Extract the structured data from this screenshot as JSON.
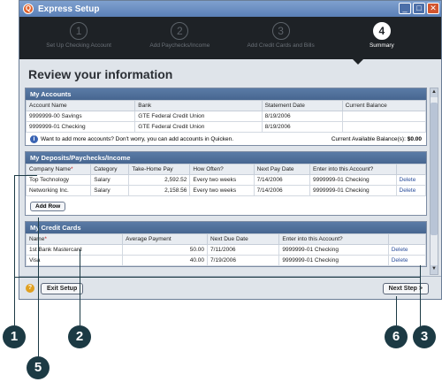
{
  "window": {
    "title": "Express Setup"
  },
  "steps": [
    {
      "num": "1",
      "label": "Set Up Checking Account"
    },
    {
      "num": "2",
      "label": "Add Paychecks/Income"
    },
    {
      "num": "3",
      "label": "Add Credit Cards and Bills"
    },
    {
      "num": "4",
      "label": "Summary"
    }
  ],
  "page_title": "Review your information",
  "accounts": {
    "title": "My Accounts",
    "headers": [
      "Account Name",
      "Bank",
      "Statement Date",
      "Current Balance"
    ],
    "rows": [
      [
        "9999999-00 Savings",
        "GTE Federal Credit Union",
        "8/19/2006",
        ""
      ],
      [
        "9999999-01 Checking",
        "GTE Federal Credit Union",
        "8/19/2006",
        ""
      ]
    ],
    "info": "Want to add more accounts? Don't worry, you can add accounts in Quicken.",
    "balance_label": "Current Available Balance(s):",
    "balance_value": "$0.00"
  },
  "deposits": {
    "title": "My Deposits/Paychecks/Income",
    "headers": [
      "Company Name",
      "Category",
      "Take-Home Pay",
      "How Often?",
      "Next Pay Date",
      "Enter into this Account?",
      ""
    ],
    "rows": [
      [
        "Top Technology",
        "Salary",
        "2,592.52",
        "Every two weeks",
        "7/14/2006",
        "9999999-01 Checking",
        "Delete"
      ],
      [
        "Networking Inc.",
        "Salary",
        "2,158.56",
        "Every two weeks",
        "7/14/2006",
        "9999999-01 Checking",
        "Delete"
      ]
    ],
    "add_row": "Add Row"
  },
  "credit": {
    "title": "My Credit Cards",
    "headers": [
      "Name",
      "Average Payment",
      "Next Due Date",
      "Enter into this Account?",
      ""
    ],
    "rows": [
      [
        "1st Bank Mastercard",
        "50.00",
        "7/11/2006",
        "9999999-01 Checking",
        "Delete"
      ],
      [
        "Visa",
        "40.00",
        "7/19/2006",
        "9999999-01 Checking",
        "Delete"
      ]
    ]
  },
  "footer": {
    "exit": "Exit Setup",
    "next": "Next Step >"
  },
  "callouts": [
    "1",
    "2",
    "3",
    "5",
    "6"
  ]
}
